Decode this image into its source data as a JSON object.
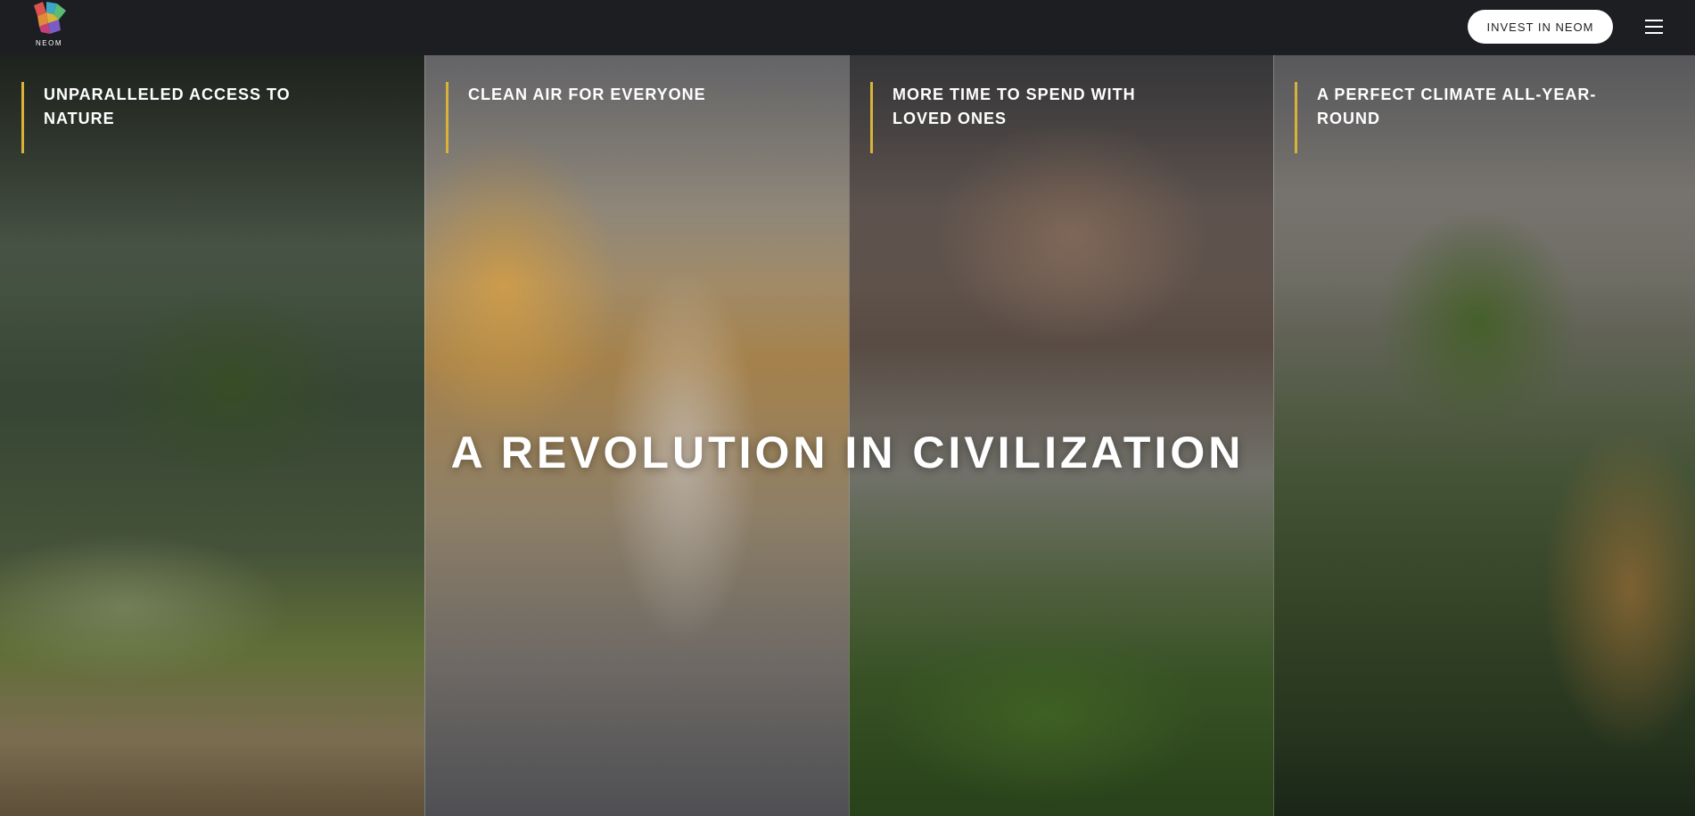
{
  "header": {
    "logo_text": "NEOM",
    "invest_label": "INVEST IN NEOM",
    "menu_icon": "hamburger-menu-icon",
    "background": "#1d1e22"
  },
  "panels": [
    {
      "label": "UNPARALLELED ACCESS TO NATURE"
    },
    {
      "label": "CLEAN AIR FOR EVERYONE"
    },
    {
      "label": "MORE TIME TO SPEND WITH LOVED ONES"
    },
    {
      "label": "A PERFECT CLIMATE ALL-YEAR-ROUND"
    }
  ],
  "headline": "A REVOLUTION IN CIVILIZATION",
  "colors": {
    "accent": "#d9b23a",
    "text": "#ffffff"
  }
}
